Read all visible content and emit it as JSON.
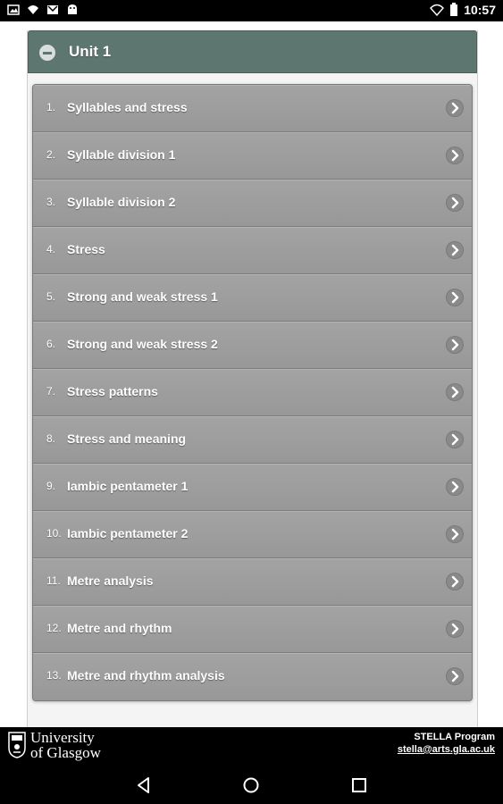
{
  "status_bar": {
    "time": "10:57",
    "left_icons": [
      "image-icon",
      "wifi-question-icon",
      "mail-icon",
      "android-icon"
    ],
    "right_icons": [
      "wifi-icon",
      "battery-icon"
    ]
  },
  "unit": {
    "title": "Unit 1",
    "header_color": "#5e7670",
    "lessons": [
      {
        "number": "1.",
        "title": "Syllables and stress"
      },
      {
        "number": "2.",
        "title": "Syllable division 1"
      },
      {
        "number": "3.",
        "title": "Syllable division 2"
      },
      {
        "number": "4.",
        "title": "Stress"
      },
      {
        "number": "5.",
        "title": "Strong and weak stress 1"
      },
      {
        "number": "6.",
        "title": "Strong and weak stress 2"
      },
      {
        "number": "7.",
        "title": "Stress patterns"
      },
      {
        "number": "8.",
        "title": "Stress and meaning"
      },
      {
        "number": "9.",
        "title": "Iambic pentameter 1"
      },
      {
        "number": "10.",
        "title": "Iambic pentameter 2"
      },
      {
        "number": "11.",
        "title": "Metre analysis"
      },
      {
        "number": "12.",
        "title": "Metre and rhythm"
      },
      {
        "number": "13.",
        "title": "Metre and rhythm analysis"
      }
    ]
  },
  "footer": {
    "university_line1": "University",
    "university_line2": "of Glasgow",
    "program": "STELLA Program",
    "email": "stella@arts.gla.ac.uk"
  },
  "nav": {
    "buttons": [
      "back-icon",
      "home-icon",
      "recents-icon"
    ]
  }
}
